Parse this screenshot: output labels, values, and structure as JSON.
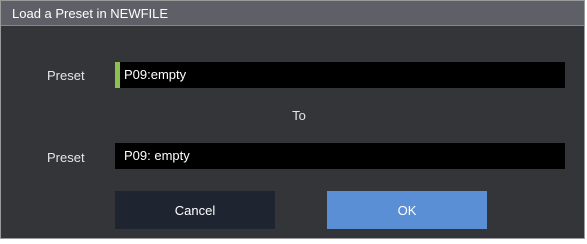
{
  "dialog": {
    "title": "Load a Preset in NEWFILE",
    "source": {
      "label": "Preset",
      "value": "P09:empty"
    },
    "connector": "To",
    "destination": {
      "label": "Preset",
      "value": "P09: empty"
    },
    "buttons": {
      "cancel": "Cancel",
      "ok": "OK"
    }
  },
  "colors": {
    "dialog_bg": "#333539",
    "titlebar_bg": "#5d6066",
    "field_bg": "#000000",
    "focus_accent": "#8fc14f",
    "cancel_bg": "#1f2431",
    "ok_bg": "#5a8fd6"
  }
}
